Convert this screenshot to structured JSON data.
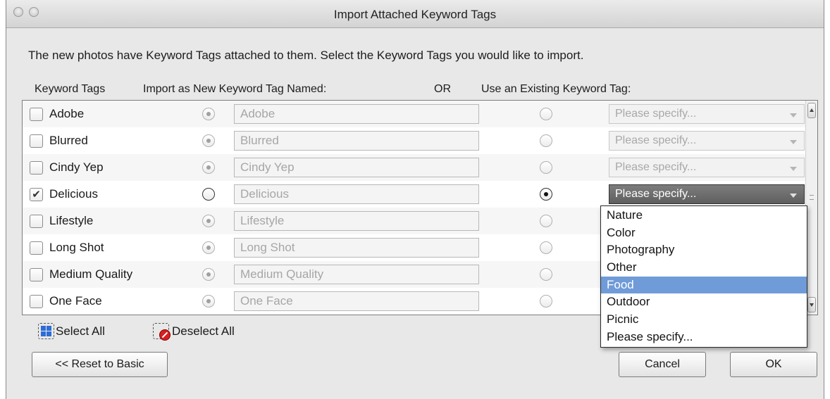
{
  "window": {
    "title": "Import Attached Keyword Tags"
  },
  "instructions": "The new photos have Keyword Tags attached to them.  Select the Keyword Tags you would like to import.",
  "columns": {
    "keyword_tags": "Keyword Tags",
    "import_as_new": "Import as New Keyword Tag Named:",
    "or": "OR",
    "use_existing": "Use an Existing Keyword Tag:"
  },
  "rows": [
    {
      "tag": "Adobe",
      "checked": false,
      "new_name": "Adobe",
      "existing": "Please specify...",
      "mode": "new"
    },
    {
      "tag": "Blurred",
      "checked": false,
      "new_name": "Blurred",
      "existing": "Please specify...",
      "mode": "new"
    },
    {
      "tag": "Cindy Yep",
      "checked": false,
      "new_name": "Cindy Yep",
      "existing": "Please specify...",
      "mode": "new"
    },
    {
      "tag": "Delicious",
      "checked": true,
      "new_name": "Delicious",
      "existing": "Please specify...",
      "mode": "existing"
    },
    {
      "tag": "Lifestyle",
      "checked": false,
      "new_name": "Lifestyle",
      "existing": "",
      "mode": "new"
    },
    {
      "tag": "Long Shot",
      "checked": false,
      "new_name": "Long Shot",
      "existing": "",
      "mode": "new"
    },
    {
      "tag": "Medium Quality",
      "checked": false,
      "new_name": "Medium Quality",
      "existing": "",
      "mode": "new"
    },
    {
      "tag": "One Face",
      "checked": false,
      "new_name": "One Face",
      "existing": "",
      "mode": "new"
    }
  ],
  "dropdown": {
    "options": [
      "Nature",
      "Color",
      "Photography",
      "Other",
      "Food",
      "Outdoor",
      "Picnic",
      "Please specify..."
    ],
    "highlighted": "Food"
  },
  "links": {
    "select_all": "Select All",
    "deselect_all": "Deselect All"
  },
  "buttons": {
    "reset": "<< Reset to Basic",
    "cancel": "Cancel",
    "ok": "OK"
  },
  "colors": {
    "highlight": "#6f9bd8",
    "active_select": "#6a6a6a"
  },
  "icons": {
    "checkmark": "✔"
  }
}
